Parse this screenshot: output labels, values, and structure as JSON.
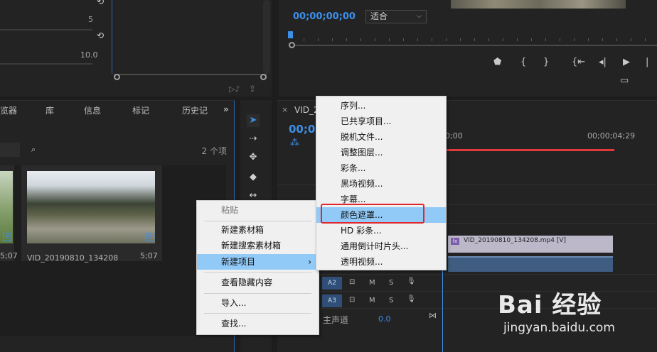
{
  "effects_panel": {
    "value_1": "5",
    "value_2": "10.0"
  },
  "program_monitor": {
    "timecode": "00;00;00;00",
    "fit_label": "适合"
  },
  "project_panel": {
    "tabs": [
      "览器",
      "库",
      "信息",
      "标记",
      "历史记"
    ],
    "overflow": "»",
    "items_count": "2 个项",
    "clips": [
      {
        "name": "",
        "duration": "5;07"
      },
      {
        "name": "VID_20190810_134208",
        "duration": "5;07"
      }
    ]
  },
  "timeline": {
    "title": "VID_2",
    "timecode": "00;0",
    "ruler_a": "0;00",
    "ruler_b": "00;00;04;29",
    "video_clip": "VID_20190810_134208.mp4 [V]",
    "fx_label": "fx",
    "tracks": [
      {
        "name": "A2",
        "m": "M",
        "s": "S"
      },
      {
        "name": "A3",
        "m": "M",
        "s": "S"
      }
    ],
    "master_label": "主声道",
    "master_value": "0.0"
  },
  "context_menu": {
    "items": [
      "粘贴",
      "新建素材箱",
      "新建搜索素材箱",
      "新建项目",
      "查看隐藏内容",
      "导入...",
      "查找..."
    ]
  },
  "submenu": {
    "items": [
      "序列...",
      "已共享项目...",
      "脱机文件...",
      "调整图层...",
      "彩条...",
      "黑场视频...",
      "字幕...",
      "颜色遮罩...",
      "HD 彩条...",
      "通用倒计时片头...",
      "透明视频..."
    ]
  },
  "watermark": {
    "logo": "Bai 经验",
    "url": "jingyan.baidu.com"
  },
  "colors": {
    "accent": "#3d8fe8",
    "highlight": "#91c9f7",
    "callout": "#e0282c"
  }
}
